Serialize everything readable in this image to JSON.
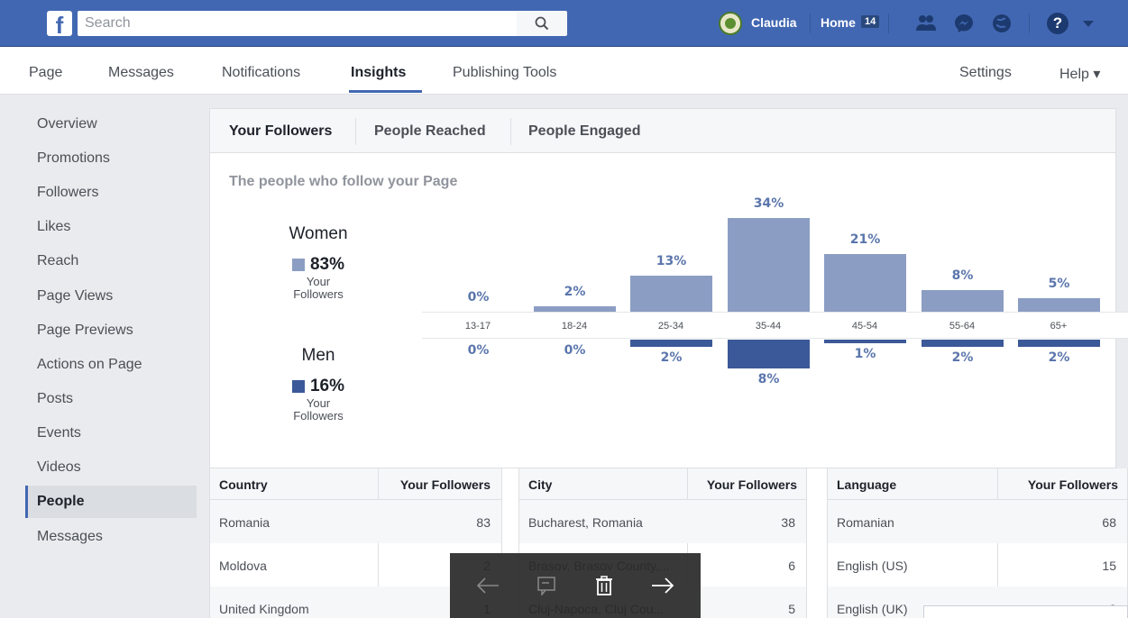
{
  "topbar": {
    "logo": "f",
    "search_placeholder": "Search",
    "user_name": "Claudia",
    "home_label": "Home",
    "home_count": "14",
    "help_label": "?"
  },
  "pagenav": {
    "items": [
      "Page",
      "Messages",
      "Notifications",
      "Insights",
      "Publishing Tools"
    ],
    "active": "Insights",
    "right_items": [
      "Settings",
      "Help ▾"
    ]
  },
  "sidebar": {
    "items": [
      "Overview",
      "Promotions",
      "Followers",
      "Likes",
      "Reach",
      "Page Views",
      "Page Previews",
      "Actions on Page",
      "Posts",
      "Events",
      "Videos",
      "People",
      "Messages"
    ],
    "active": "People"
  },
  "panel": {
    "tabs": [
      "Your Followers",
      "People Reached",
      "People Engaged"
    ],
    "subtitle": "The people who follow your Page",
    "women": {
      "title": "Women",
      "pct": "83%",
      "sub1": "Your",
      "sub2": "Followers",
      "color": "#8b9dc3"
    },
    "men": {
      "title": "Men",
      "pct": "16%",
      "sub1": "Your",
      "sub2": "Followers",
      "color": "#3b5998"
    }
  },
  "chart_data": {
    "type": "bar",
    "categories": [
      "13-17",
      "18-24",
      "25-34",
      "35-44",
      "45-54",
      "55-64",
      "65+"
    ],
    "series": [
      {
        "name": "Women",
        "values": [
          0,
          2,
          13,
          34,
          21,
          8,
          5
        ],
        "labels": [
          "0%",
          "2%",
          "13%",
          "34%",
          "21%",
          "8%",
          "5%"
        ]
      },
      {
        "name": "Men",
        "values": [
          0,
          0,
          2,
          8,
          1,
          2,
          2
        ],
        "labels": [
          "0%",
          "0%",
          "2%",
          "8%",
          "1%",
          "2%",
          "2%"
        ]
      }
    ],
    "title": "",
    "xlabel": "",
    "ylabel": ""
  },
  "tables": {
    "country": {
      "h1": "Country",
      "h2": "Your Followers",
      "rows": [
        [
          "Romania",
          "83"
        ],
        [
          "Moldova",
          "2"
        ],
        [
          "United Kingdom",
          "1"
        ]
      ]
    },
    "city": {
      "h1": "City",
      "h2": "Your Followers",
      "rows": [
        [
          "Bucharest, Romania",
          "38"
        ],
        [
          "Brasov, Brasov County,...",
          "6"
        ],
        [
          "Cluj-Napoca, Cluj Cou...",
          "5"
        ]
      ]
    },
    "language": {
      "h1": "Language",
      "h2": "Your Followers",
      "rows": [
        [
          "Romanian",
          "68"
        ],
        [
          "English (US)",
          "15"
        ],
        [
          "English (UK)",
          "2"
        ]
      ]
    }
  }
}
